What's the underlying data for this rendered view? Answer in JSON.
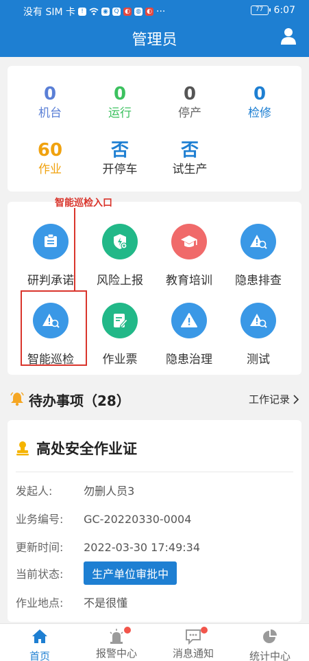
{
  "status_bar": {
    "carrier": "没有 SIM 卡",
    "battery": "77",
    "time": "6:07",
    "more": "···"
  },
  "header": {
    "title": "管理员"
  },
  "stats": [
    {
      "value": "0",
      "label": "机台",
      "color": "#5a7fd6"
    },
    {
      "value": "0",
      "label": "运行",
      "color": "#3cc15f"
    },
    {
      "value": "0",
      "label": "停产",
      "color": "#555555"
    },
    {
      "value": "0",
      "label": "检修",
      "color": "#1e7fd2"
    },
    {
      "value": "60",
      "label": "作业",
      "color": "#f0a20f"
    },
    {
      "value": "否",
      "label": "开停车",
      "color": "#1e7fd2"
    },
    {
      "value": "否",
      "label": "试生产",
      "color": "#1e7fd2"
    }
  ],
  "annotation": {
    "text": "智能巡检入口"
  },
  "apps": [
    {
      "label": "研判承诺",
      "color": "#3a98e6",
      "icon": "clipboard-icon"
    },
    {
      "label": "风险上报",
      "color": "#22b888",
      "icon": "shield-icon"
    },
    {
      "label": "教育培训",
      "color": "#f06a6a",
      "icon": "graduation-cap-icon"
    },
    {
      "label": "隐患排查",
      "color": "#3a98e6",
      "icon": "warning-search-icon"
    },
    {
      "label": "智能巡检",
      "color": "#3a98e6",
      "icon": "warning-search-icon"
    },
    {
      "label": "作业票",
      "color": "#22b888",
      "icon": "edit-document-icon"
    },
    {
      "label": "隐患治理",
      "color": "#3a98e6",
      "icon": "warning-icon"
    },
    {
      "label": "测试",
      "color": "#3a98e6",
      "icon": "warning-search-icon"
    }
  ],
  "todo": {
    "title": "待办事项（28）",
    "link": "工作记录"
  },
  "todo_card": {
    "title": "高处安全作业证",
    "rows": [
      {
        "label": "发起人:",
        "value": "勿删人员3"
      },
      {
        "label": "业务编号:",
        "value": "GC-20220330-0004"
      },
      {
        "label": "更新时间:",
        "value": "2022-03-30 17:49:34"
      },
      {
        "label": "当前状态:",
        "value": "生产单位审批中"
      },
      {
        "label": "作业地点:",
        "value": "不是很懂"
      }
    ]
  },
  "nav": [
    {
      "label": "首页",
      "active": true
    },
    {
      "label": "报警中心",
      "badge": true
    },
    {
      "label": "消息通知",
      "badge": true
    },
    {
      "label": "统计中心"
    }
  ]
}
